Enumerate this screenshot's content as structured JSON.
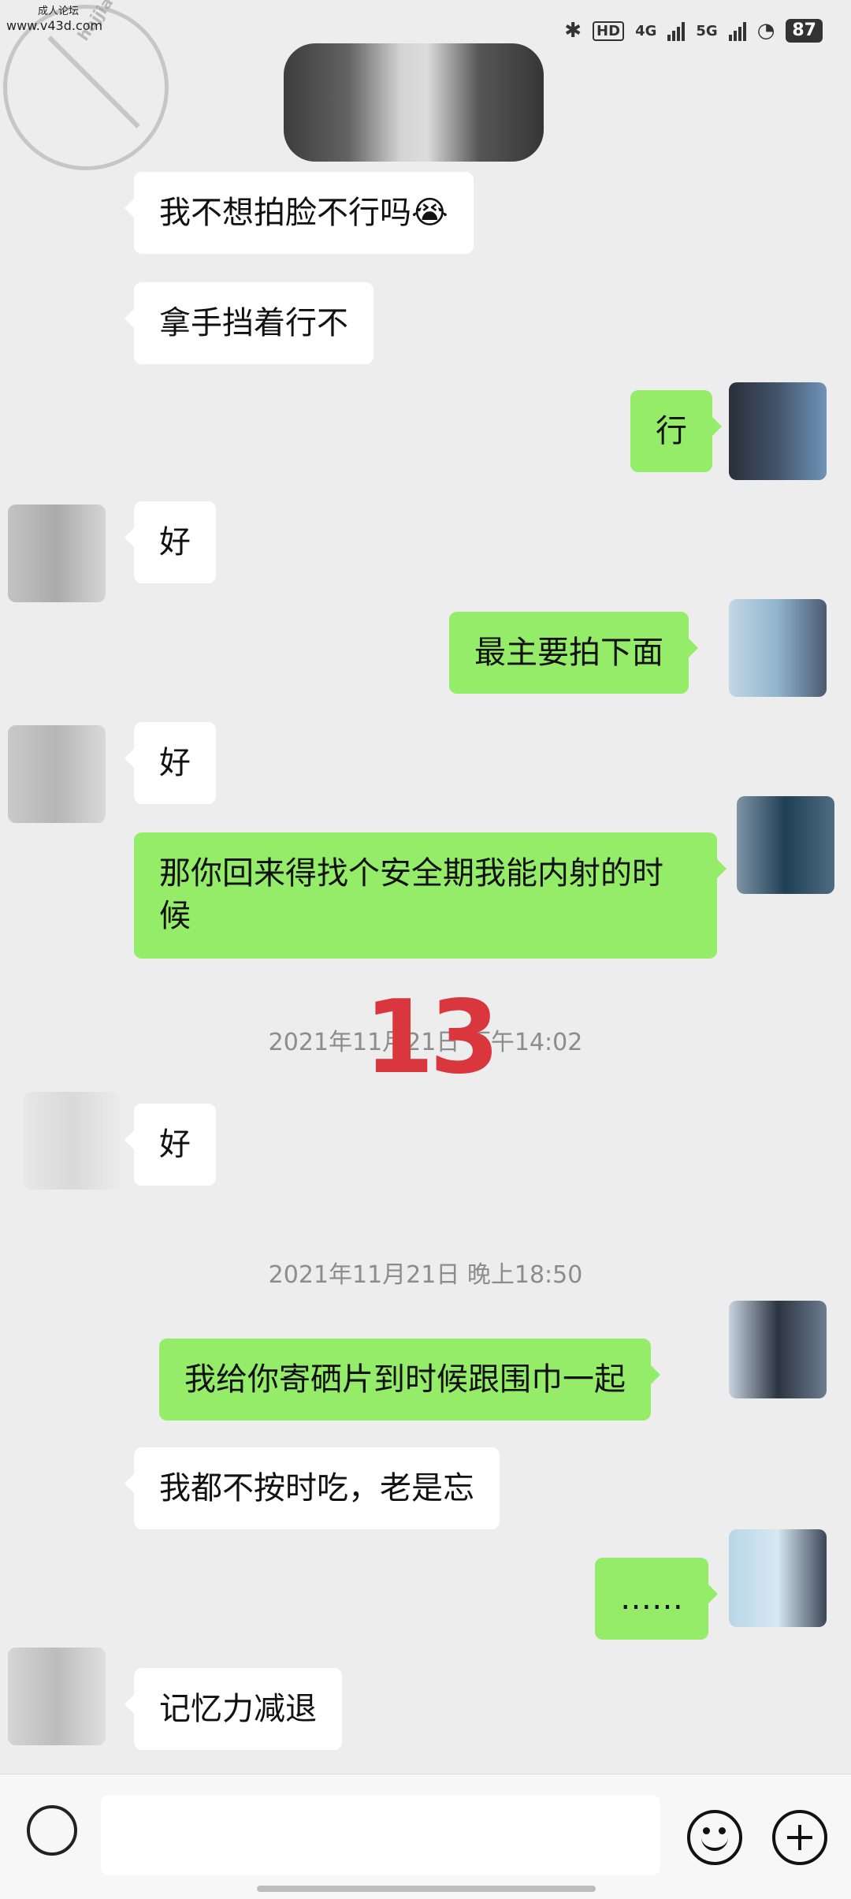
{
  "status_bar": {
    "watermark_top": "成人论坛",
    "watermark_site": "www.v43d.com",
    "watermark_ring": "hajjiao.com 海角社区",
    "network_1": "4G",
    "network_2": "5G",
    "hd_label": "HD",
    "battery": "87"
  },
  "messages": [
    {
      "side": "recv",
      "text": "我不想拍脸不行吗😭"
    },
    {
      "side": "recv",
      "text": "拿手挡着行不"
    },
    {
      "side": "sent",
      "text": "行"
    },
    {
      "side": "recv",
      "text": "好"
    },
    {
      "side": "sent",
      "text": "最主要拍下面"
    },
    {
      "side": "recv",
      "text": "好"
    },
    {
      "side": "sent",
      "text": "那你回来得找个安全期我能内射的时候"
    },
    {
      "side": "recv",
      "text": "好"
    },
    {
      "side": "sent",
      "text": "我给你寄硒片到时候跟围巾一起"
    },
    {
      "side": "recv",
      "text": "我都不按时吃，老是忘"
    },
    {
      "side": "sent",
      "text": "……"
    },
    {
      "side": "recv",
      "text": "记忆力减退"
    }
  ],
  "timestamps": [
    "2021年11月21日 下午14:02",
    "2021年11月21日 晚上18:50"
  ],
  "overlay_number": "13",
  "colors": {
    "background": "#ededed",
    "sent_bubble": "#95ec69",
    "recv_bubble": "#ffffff",
    "timestamp": "#8c8c8c",
    "overlay_number": "#d9363e"
  },
  "icons": {
    "voice": "voice-input-icon",
    "emoji": "emoji-icon",
    "more": "plus-icon"
  }
}
